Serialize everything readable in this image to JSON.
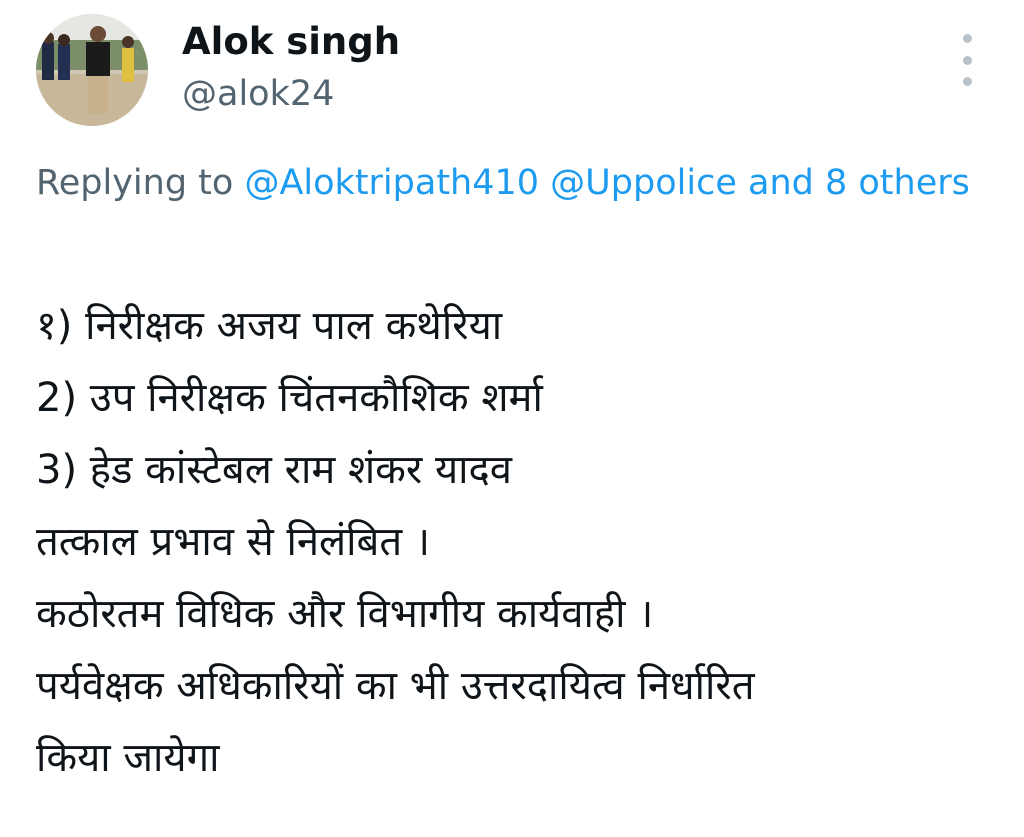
{
  "header": {
    "display_name": "Alok singh",
    "handle": "@alok24",
    "avatar_icon": "profile-photo",
    "more_icon": "vertical-ellipsis-icon"
  },
  "reply": {
    "prefix": "Replying to",
    "mention_1": "@Aloktripath410",
    "mention_2": "@Uppolice",
    "mention_3": "and 8 others"
  },
  "tweet": {
    "lines": [
      "१) निरीक्षक अजय पाल कथेरिया",
      "2) उप निरीक्षक चिंतनकौशिक शर्मा",
      "3) हेड कांस्टेबल राम शंकर यादव",
      "तत्काल प्रभाव से निलंबित ।",
      "कठोरतम विधिक और विभागीय कार्यवाही ।",
      "पर्यवेक्षक अधिकारियों का भी उत्तरदायित्व निर्धारित",
      "किया जायेगा"
    ]
  },
  "colors": {
    "text": "#0f1419",
    "secondary": "#536471",
    "link": "#1d9bf0",
    "icon": "#b8c2cb"
  }
}
